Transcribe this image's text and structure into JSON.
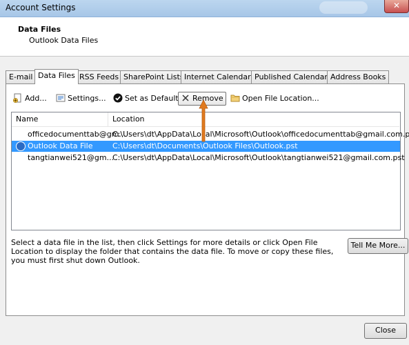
{
  "window": {
    "title": "Account Settings"
  },
  "header": {
    "title": "Data Files",
    "subtitle": "Outlook Data Files"
  },
  "tabs": [
    {
      "label": "E-mail"
    },
    {
      "label": "Data Files"
    },
    {
      "label": "RSS Feeds"
    },
    {
      "label": "SharePoint Lists"
    },
    {
      "label": "Internet Calendars"
    },
    {
      "label": "Published Calendars"
    },
    {
      "label": "Address Books"
    }
  ],
  "toolbar": {
    "add": "Add...",
    "settings": "Settings...",
    "set_default": "Set as Default",
    "remove": "Remove",
    "open_location": "Open File Location..."
  },
  "table": {
    "columns": [
      "Name",
      "Location"
    ],
    "rows": [
      {
        "name": "officedocumenttab@gm...",
        "location": "C:\\Users\\dt\\AppData\\Local\\Microsoft\\Outlook\\officedocumenttab@gmail.com.pst"
      },
      {
        "name": "Outlook Data File",
        "location": "C:\\Users\\dt\\Documents\\Outlook Files\\Outlook.pst"
      },
      {
        "name": "tangtianwei521@gm...",
        "location": "C:\\Users\\dt\\AppData\\Local\\Microsoft\\Outlook\\tangtianwei521@gmail.com.pst"
      }
    ]
  },
  "help_text": "Select a data file in the list, then click Settings for more details or click Open File Location to display the folder that contains the data file. To move or copy these files, you must first shut down Outlook.",
  "buttons": {
    "tell_me_more": "Tell Me More...",
    "close": "Close"
  },
  "colors": {
    "selection": "#3399ff",
    "arrow": "#e07a1f"
  }
}
